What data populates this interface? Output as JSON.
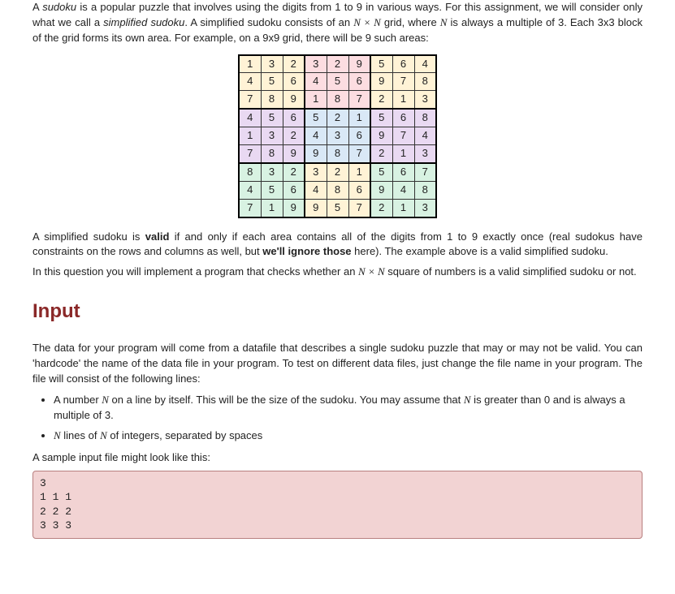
{
  "para1_a": "A ",
  "para1_sudoku": "sudoku",
  "para1_b": " is a popular puzzle that involves using the digits from 1 to 9 in various ways. For this assignment, we will consider only what we call a ",
  "para1_simplified": "simplified sudoku",
  "para1_c": ". A simplified sudoku consists of an ",
  "para1_nn": "N × N",
  "para1_d": " grid, where ",
  "para1_n": "N",
  "para1_e": " is always a multiple of 3. Each 3x3 block of the grid forms its own area. For example, on a 9x9 grid, there will be 9 such areas:",
  "grid": [
    [
      1,
      3,
      2,
      3,
      2,
      9,
      5,
      6,
      4
    ],
    [
      4,
      5,
      6,
      4,
      5,
      6,
      9,
      7,
      8
    ],
    [
      7,
      8,
      9,
      1,
      8,
      7,
      2,
      1,
      3
    ],
    [
      4,
      5,
      6,
      5,
      2,
      1,
      5,
      6,
      8
    ],
    [
      1,
      3,
      2,
      4,
      3,
      6,
      9,
      7,
      4
    ],
    [
      7,
      8,
      9,
      9,
      8,
      7,
      2,
      1,
      3
    ],
    [
      8,
      3,
      2,
      3,
      2,
      1,
      5,
      6,
      7
    ],
    [
      4,
      5,
      6,
      4,
      8,
      6,
      9,
      4,
      8
    ],
    [
      7,
      1,
      9,
      9,
      5,
      7,
      2,
      1,
      3
    ]
  ],
  "para2_a": "A simplified sudoku is ",
  "para2_valid": "valid",
  "para2_b": " if and only if each area contains all of the digits from 1 to 9 exactly once (real sudokus have constraints on the rows and columns as well, but ",
  "para2_ignore": "we'll ignore those",
  "para2_c": " here).  The example above is a valid simplified sudoku.",
  "para3_a": "In this question you will implement a program that checks whether an ",
  "para3_nn": "N × N",
  "para3_b": " square of numbers is a valid simplified sudoku or not.",
  "input_hdr": "Input",
  "para4": "The data for your program will come from a datafile that describes a single sudoku puzzle that may or may not be valid. You can 'hardcode' the name of the data file in your program. To test on different data files, just change the file name in your program. The file will consist of the following lines:",
  "bullet1_a": "A number ",
  "bullet1_n1": "N",
  "bullet1_b": " on a line by itself. This will be the size of the sudoku. You may assume that ",
  "bullet1_n2": "N",
  "bullet1_c": " is greater than 0 and is always a multiple of 3.",
  "bullet2_n": "N",
  "bullet2_a": " lines of ",
  "bullet2_n2": "N",
  "bullet2_b": " of integers, separated by spaces",
  "para5": "A sample input file might look like this:",
  "sample": "3\n1 1 1\n2 2 2\n3 3 3"
}
